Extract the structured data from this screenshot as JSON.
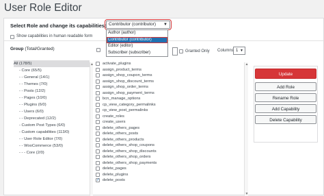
{
  "page_title": "User Role Editor",
  "role_selector": {
    "label": "Select Role and change its capabilities:",
    "selected": "Contributor (contributor)",
    "options": [
      "Author (author)",
      "Contributor (contributor)",
      "Editor (editor)",
      "Subscriber (subscriber)"
    ]
  },
  "human_readable_label": "Show capabilities in human readable form",
  "groups": {
    "title": "Group",
    "subtitle": "(Total/Granted)",
    "items": [
      "All (178/5)",
      "- Core (65/5)",
      "- - General (14/1)",
      "- - Themes (7/0)",
      "- - Posts (12/2)",
      "- - Pages (10/0)",
      "- - Plugins (6/0)",
      "- - Users (6/0)",
      "- - Deprecated (12/2)",
      "- Custom Post Types (6/0)",
      "- Custom capabilities (113/0)",
      "- - User Role Editor (7/0)",
      "- - WooCommerce (53/0)",
      "- - - Core (2/0)"
    ]
  },
  "filters": {
    "granted_only_label": "Granted Only",
    "columns_label": "Columns:",
    "columns_value": "1"
  },
  "capabilities": [
    {
      "name": "activate_plugins",
      "checked": false
    },
    {
      "name": "assign_product_terms",
      "checked": false
    },
    {
      "name": "assign_shop_coupon_terms",
      "checked": false
    },
    {
      "name": "assign_shop_discount_terms",
      "checked": false
    },
    {
      "name": "assign_shop_order_terms",
      "checked": false
    },
    {
      "name": "assign_shop_payment_terms",
      "checked": false
    },
    {
      "name": "bcn_manage_options",
      "checked": false
    },
    {
      "name": "cp_view_category_permalinks",
      "checked": false
    },
    {
      "name": "cp_view_post_permalinks",
      "checked": false
    },
    {
      "name": "create_roles",
      "checked": false
    },
    {
      "name": "create_users",
      "checked": false
    },
    {
      "name": "delete_others_pages",
      "checked": false
    },
    {
      "name": "delete_others_posts",
      "checked": false
    },
    {
      "name": "delete_others_products",
      "checked": false
    },
    {
      "name": "delete_others_shop_coupons",
      "checked": false
    },
    {
      "name": "delete_others_shop_discounts",
      "checked": false
    },
    {
      "name": "delete_others_shop_orders",
      "checked": false
    },
    {
      "name": "delete_others_shop_payments",
      "checked": false
    },
    {
      "name": "delete_pages",
      "checked": false
    },
    {
      "name": "delete_plugins",
      "checked": false
    },
    {
      "name": "delete_posts",
      "checked": true
    }
  ],
  "actions": {
    "update": "Update",
    "add_role": "Add Role",
    "rename_role": "Rename Role",
    "add_capability": "Add Capability",
    "delete_capability": "Delete Capability"
  }
}
